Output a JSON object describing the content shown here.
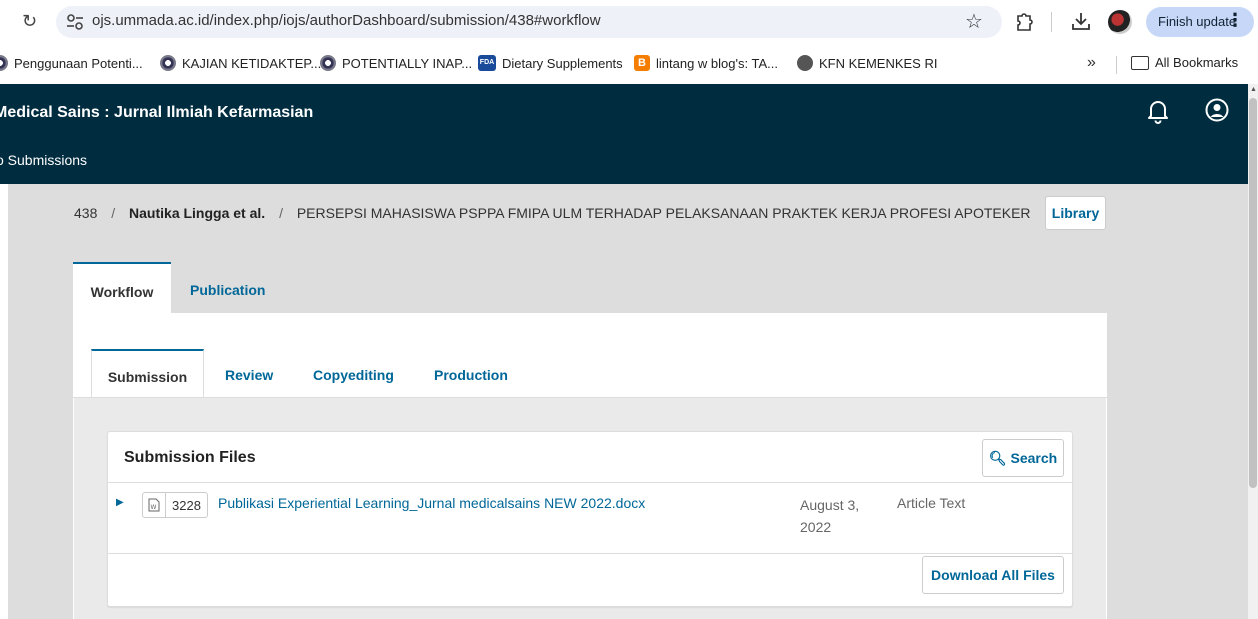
{
  "browser": {
    "url": "ojs.ummada.ac.id/index.php/iojs/authorDashboard/submission/438#workflow",
    "finish_update_label": "Finish update",
    "bookmarks": [
      {
        "label": "Penggunaan Potenti...",
        "icon": "globe-icon"
      },
      {
        "label": "KAJIAN KETIDAKTEP...",
        "icon": "globe-icon"
      },
      {
        "label": "POTENTIALLY INAP...",
        "icon": "globe-icon"
      },
      {
        "label": "Dietary Supplements",
        "icon": "fda-icon"
      },
      {
        "label": "lintang w blog's: TA...",
        "icon": "blogger-icon"
      },
      {
        "label": "KFN KEMENKES RI",
        "icon": "world-icon"
      }
    ],
    "more_bookmarks": "»",
    "all_bookmarks_label": "All Bookmarks"
  },
  "header": {
    "site_title": "Medical Sains : Jurnal Ilmiah Kefarmasian",
    "back_link": "o Submissions"
  },
  "breadcrumb": {
    "id": "438",
    "authors": "Nautika Lingga et al.",
    "title": "PERSEPSI MAHASISWA PSPPA FMIPA ULM TERHADAP PELAKSANAAN PRAKTEK KERJA PROFESI APOTEKER",
    "separator": "/"
  },
  "library_label": "Library",
  "main_tabs": [
    {
      "label": "Workflow",
      "active": true
    },
    {
      "label": "Publication",
      "active": false
    }
  ],
  "stage_tabs": [
    {
      "label": "Submission",
      "active": true
    },
    {
      "label": "Review",
      "active": false
    },
    {
      "label": "Copyediting",
      "active": false
    },
    {
      "label": "Production",
      "active": false
    }
  ],
  "files": {
    "title": "Submission Files",
    "search_label": "Search",
    "rows": [
      {
        "id": "3228",
        "name": "Publikasi Experiential Learning_Jurnal medicalsains NEW 2022.docx",
        "date": "August 3, 2022",
        "type": "Article Text"
      }
    ],
    "download_all_label": "Download All Files"
  },
  "colors": {
    "header_bg": "#002c40",
    "link": "#006798"
  }
}
